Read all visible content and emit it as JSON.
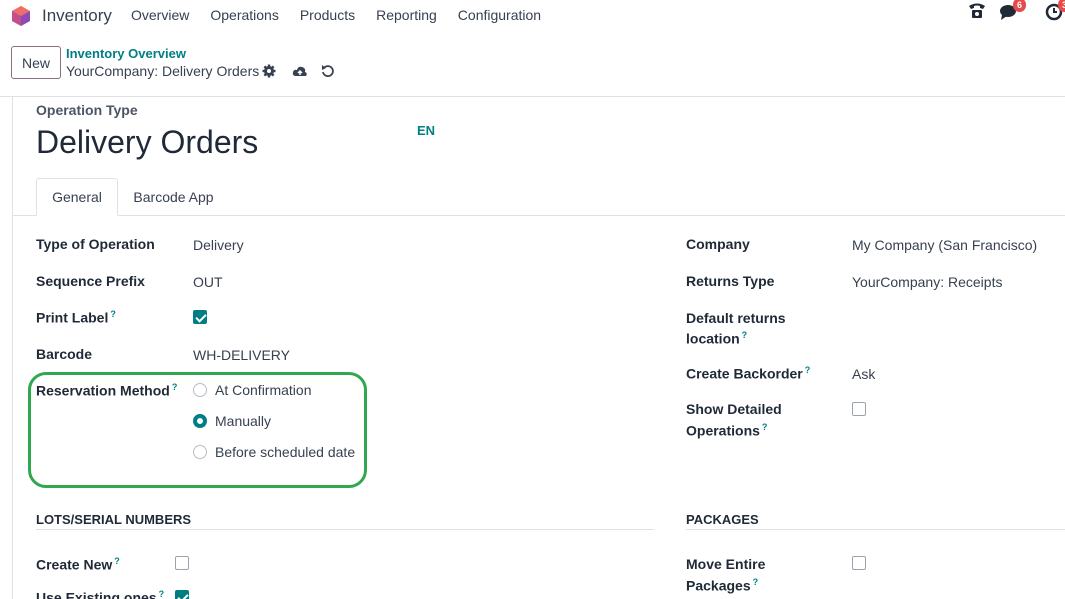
{
  "nav": {
    "app_name": "Inventory",
    "menu": [
      "Overview",
      "Operations",
      "Products",
      "Reporting",
      "Configuration"
    ],
    "messages_badge": "6",
    "activity_badge": "3"
  },
  "control": {
    "new_label": "New",
    "breadcrumb_parent": "Inventory Overview",
    "breadcrumb_current": "YourCompany: Delivery Orders"
  },
  "form": {
    "type_caption": "Operation Type",
    "title": "Delivery Orders",
    "lang": "EN",
    "tabs": [
      "General",
      "Barcode App"
    ],
    "left": {
      "type_of_operation_label": "Type of Operation",
      "type_of_operation_value": "Delivery",
      "sequence_prefix_label": "Sequence Prefix",
      "sequence_prefix_value": "OUT",
      "print_label_label": "Print Label",
      "print_label_checked": true,
      "barcode_label": "Barcode",
      "barcode_value": "WH-DELIVERY",
      "reservation_label": "Reservation Method",
      "reservation_options": [
        "At Confirmation",
        "Manually",
        "Before scheduled date"
      ],
      "reservation_selected": "Manually"
    },
    "right": {
      "company_label": "Company",
      "company_value": "My Company (San Francisco)",
      "returns_type_label": "Returns Type",
      "returns_type_value": "YourCompany: Receipts",
      "default_returns_label_1": "Default returns",
      "default_returns_label_2": "location",
      "create_backorder_label": "Create Backorder",
      "create_backorder_value": "Ask",
      "show_detailed_label_1": "Show Detailed",
      "show_detailed_label_2": "Operations"
    },
    "lots": {
      "title": "LOTS/SERIAL NUMBERS",
      "create_new_label": "Create New",
      "use_existing_label": "Use Existing ones"
    },
    "packages": {
      "title": "PACKAGES",
      "move_entire_label_1": "Move Entire",
      "move_entire_label_2": "Packages"
    },
    "help_mark": "?"
  },
  "colors": {
    "accent": "#017e84",
    "highlight": "#2fa84f",
    "badge": "#e54b4b"
  }
}
